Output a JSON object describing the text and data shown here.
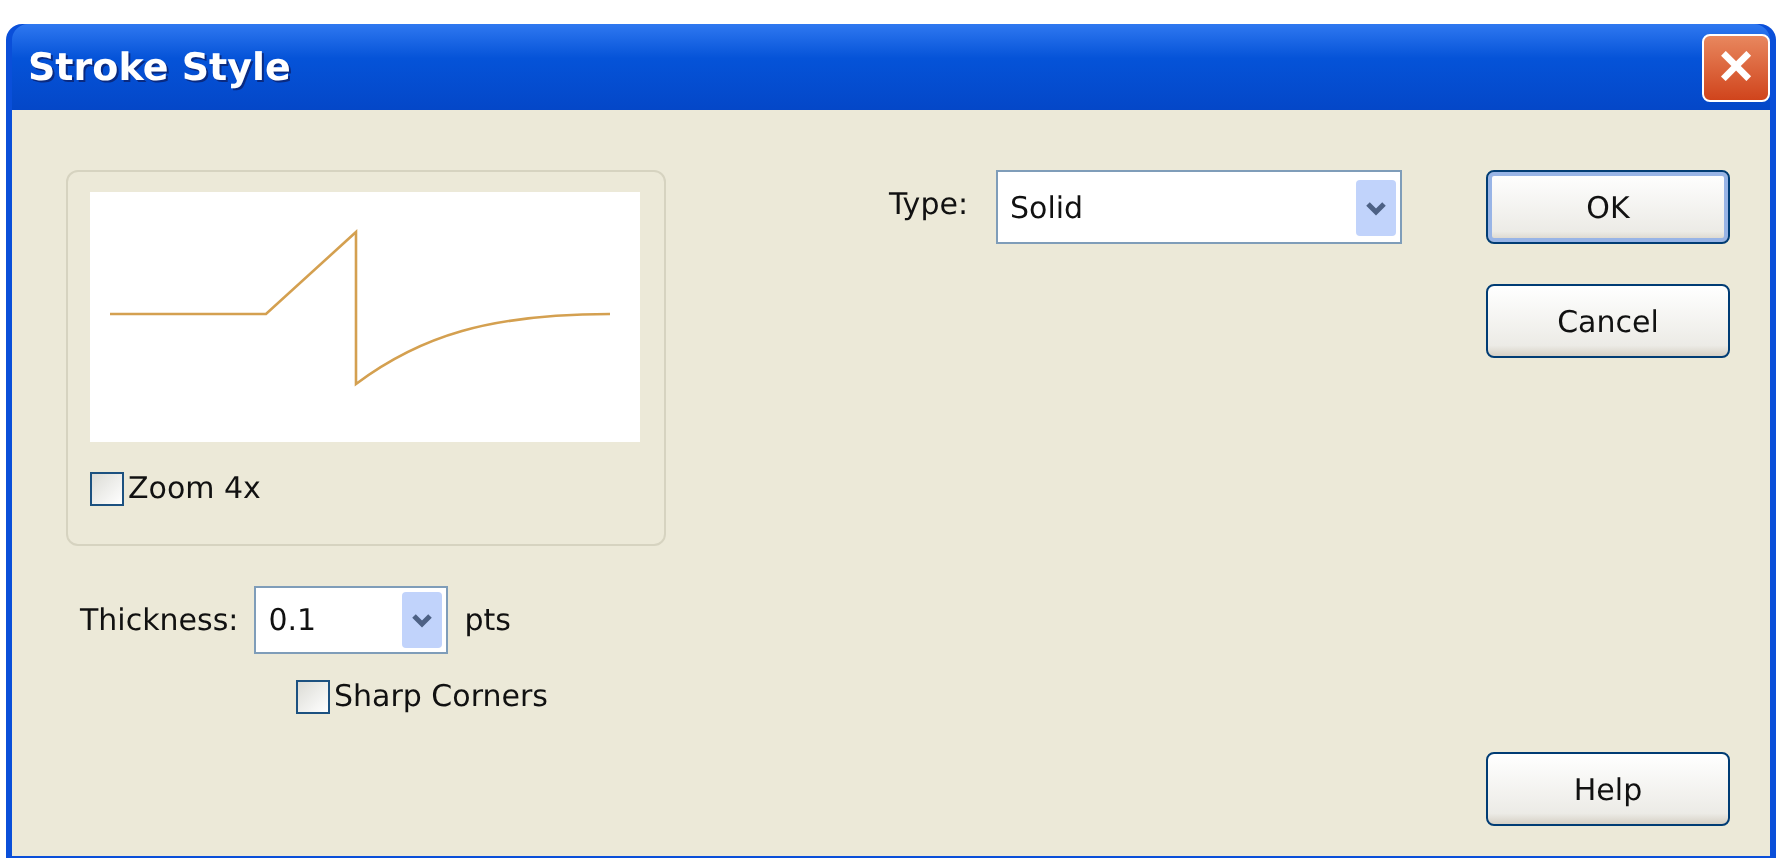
{
  "window": {
    "title": "Stroke Style",
    "close": "×"
  },
  "preview": {
    "zoom": {
      "label": "Zoom 4x",
      "checked": false
    }
  },
  "thickness": {
    "label": "Thickness:",
    "value": "0.1",
    "unit": "pts"
  },
  "sharp_corners": {
    "label": "Sharp Corners",
    "checked": false
  },
  "type": {
    "label": "Type:",
    "value": "Solid"
  },
  "buttons": [
    {
      "label": "OK",
      "default": true
    },
    {
      "label": "Cancel",
      "default": false
    },
    {
      "label": "Help",
      "default": false
    }
  ]
}
